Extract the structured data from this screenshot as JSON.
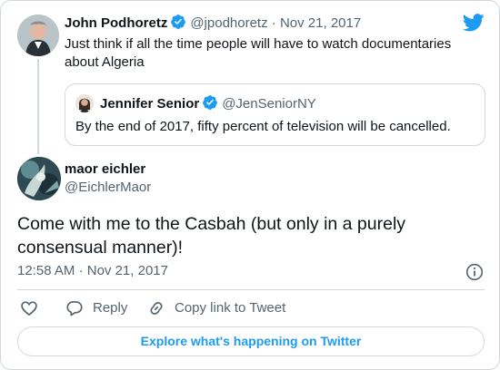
{
  "parent_tweet": {
    "display_name": "John Podhoretz",
    "handle": "@jpodhoretz",
    "separator": "·",
    "date": "Nov 21, 2017",
    "text": "Just think if all the time people will have to watch documentaries about Algeria"
  },
  "quoted_tweet": {
    "display_name": "Jennifer Senior",
    "handle": "@JenSeniorNY",
    "text": "By the end of 2017, fifty percent of television will be cancelled."
  },
  "main_tweet": {
    "display_name": "maor eichler",
    "handle": "@EichlerMaor",
    "text": "Come with me to the Casbah (but only in a purely consensual manner)!",
    "time": "12:58 AM",
    "separator": "·",
    "date": "Nov 21, 2017"
  },
  "actions": {
    "reply_label": "Reply",
    "copy_link_label": "Copy link to Tweet"
  },
  "explore_label": "Explore what's happening on Twitter",
  "icons": {
    "brand": "twitter-bird-icon",
    "verified": "verified-badge-icon",
    "info": "info-icon",
    "like": "heart-icon",
    "reply": "speech-bubble-icon",
    "copy_link": "link-icon"
  },
  "colors": {
    "accent": "#1d9bf0",
    "text": "#0f1419",
    "muted": "#536471",
    "border": "#cfd9de"
  }
}
